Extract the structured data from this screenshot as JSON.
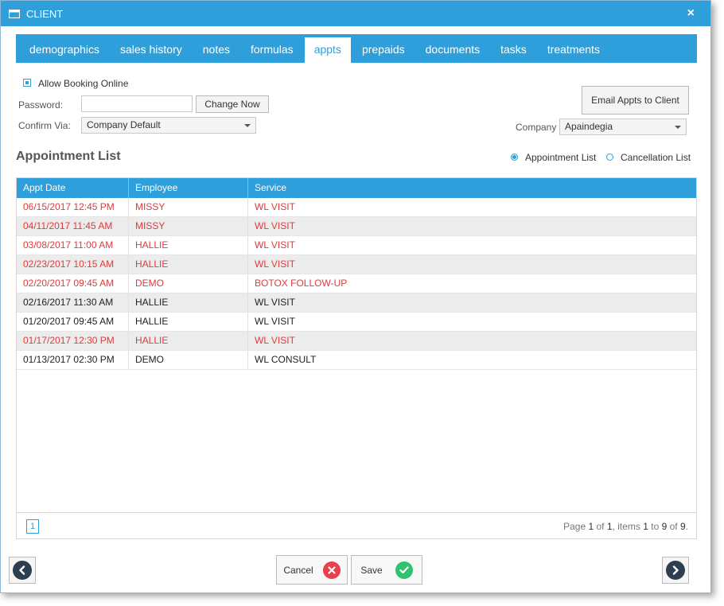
{
  "window": {
    "title": "CLIENT",
    "close_glyph": "×"
  },
  "tabs": [
    {
      "label": "demographics"
    },
    {
      "label": "sales history"
    },
    {
      "label": "notes"
    },
    {
      "label": "formulas"
    },
    {
      "label": "appts",
      "active": true
    },
    {
      "label": "prepaids"
    },
    {
      "label": "documents"
    },
    {
      "label": "tasks"
    },
    {
      "label": "treatments"
    }
  ],
  "booking": {
    "allow_online_label": "Allow Booking Online",
    "allow_online_checked": true,
    "password_label": "Password:",
    "password_value": "",
    "change_now_label": "Change Now",
    "confirm_via_label": "Confirm Via:",
    "confirm_via_value": "Company Default"
  },
  "email_button_label": "Email Appts to Client",
  "company": {
    "label": "Company",
    "value": "Apaindegia"
  },
  "section_title": "Appointment List",
  "list_toggle": {
    "appointment_label": "Appointment List",
    "cancellation_label": "Cancellation List",
    "selected": "appointment"
  },
  "grid": {
    "columns": [
      "Appt Date",
      "Employee",
      "Service"
    ],
    "rows": [
      {
        "date": "06/15/2017 12:45 PM",
        "employee": "MISSY",
        "service": "WL VISIT",
        "status": "red"
      },
      {
        "date": "04/11/2017 11:45 AM",
        "employee": "MISSY",
        "service": "WL VISIT",
        "status": "red"
      },
      {
        "date": "03/08/2017 11:00 AM",
        "employee": "HALLIE",
        "service": "WL VISIT",
        "status": "red"
      },
      {
        "date": "02/23/2017 10:15 AM",
        "employee": "HALLIE",
        "service": "WL VISIT",
        "status": "red"
      },
      {
        "date": "02/20/2017 09:45 AM",
        "employee": "DEMO",
        "service": "BOTOX FOLLOW-UP",
        "status": "red"
      },
      {
        "date": "02/16/2017 11:30 AM",
        "employee": "HALLIE",
        "service": "WL VISIT",
        "status": "black"
      },
      {
        "date": "01/20/2017 09:45 AM",
        "employee": "HALLIE",
        "service": "WL VISIT",
        "status": "black"
      },
      {
        "date": "01/17/2017 12:30 PM",
        "employee": "HALLIE",
        "service": "WL VISIT",
        "status": "red"
      },
      {
        "date": "01/13/2017 02:30 PM",
        "employee": "DEMO",
        "service": "WL CONSULT",
        "status": "black"
      }
    ]
  },
  "pager": {
    "current_page": "1",
    "text_page": "Page ",
    "page": "1",
    "text_of": " of ",
    "total_pages": "1",
    "text_items": ", items ",
    "from": "1",
    "text_to": " to ",
    "to": "9",
    "text_of2": " of ",
    "total_items": "9",
    "text_end": "."
  },
  "footer": {
    "cancel_label": "Cancel",
    "save_label": "Save"
  },
  "colors": {
    "accent": "#2e9fda",
    "alert_text": "#e03a3a",
    "cancel_icon": "#e8414a",
    "save_icon": "#2ec46b",
    "nav_icon": "#2d3e50"
  },
  "icons": {
    "window": "window-icon",
    "close": "close-icon",
    "prev": "arrow-left-icon",
    "next": "arrow-right-icon",
    "cancel": "x-circle-icon",
    "save": "check-circle-icon"
  }
}
